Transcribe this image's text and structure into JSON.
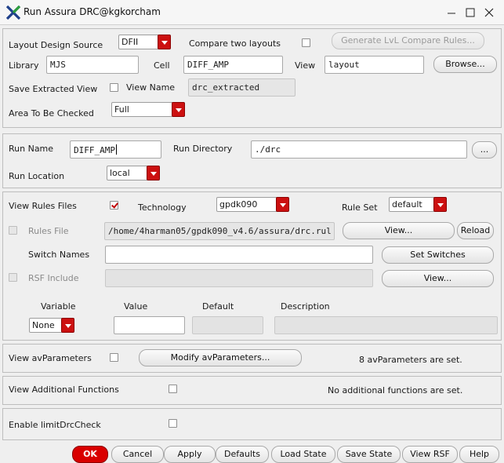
{
  "window": {
    "title": "Run Assura DRC@kgkorcham"
  },
  "layout_section": {
    "design_source_label": "Layout Design Source",
    "design_source_value": "DFII",
    "compare_label": "Compare two layouts",
    "compare_checked": false,
    "generate_button": "Generate LvL Compare Rules...",
    "library_label": "Library",
    "library_value": "MJS",
    "cell_label": "Cell",
    "cell_value": "DIFF_AMP",
    "view_label": "View",
    "view_value": "layout",
    "browse_button": "Browse...",
    "save_extracted_label": "Save Extracted View",
    "save_extracted_checked": false,
    "view_name_label": "View Name",
    "view_name_value": "drc_extracted",
    "area_label": "Area To Be Checked",
    "area_value": "Full"
  },
  "run_section": {
    "run_name_label": "Run Name",
    "run_name_value": "DIFF_AMP",
    "run_dir_label": "Run Directory",
    "run_dir_value": "./drc",
    "run_dir_browse": "...",
    "run_location_label": "Run Location",
    "run_location_value": "local"
  },
  "rules_section": {
    "view_rules_label": "View Rules Files",
    "view_rules_checked": true,
    "technology_label": "Technology",
    "technology_value": "gpdk090",
    "rule_set_label": "Rule Set",
    "rule_set_value": "default",
    "rules_file_label": "Rules File",
    "rules_file_value": "/home/4harman05/gpdk090_v4.6/assura/drc.rul",
    "rules_view_button": "View...",
    "reload_button": "Reload",
    "switch_names_label": "Switch Names",
    "switch_names_value": "",
    "set_switches_button": "Set Switches",
    "rsf_include_label": "RSF Include",
    "rsf_view_button": "View...",
    "variable_header": "Variable",
    "value_header": "Value",
    "default_header": "Default",
    "description_header": "Description",
    "variable_value": "None"
  },
  "avparams_section": {
    "label": "View avParameters",
    "checked": false,
    "modify_button": "Modify avParameters...",
    "status": "8 avParameters are set."
  },
  "functions_section": {
    "label": "View Additional Functions",
    "checked": false,
    "status": "No additional functions are set."
  },
  "limit_section": {
    "label": "Enable limitDrcCheck",
    "checked": false
  },
  "buttons": {
    "ok": "OK",
    "cancel": "Cancel",
    "apply": "Apply",
    "defaults": "Defaults",
    "load_state": "Load State",
    "save_state": "Save State",
    "view_rsf": "View RSF",
    "help": "Help"
  },
  "colors": {
    "accent_red": "#cc1010",
    "ok_button": "#d90000",
    "background": "#efefef"
  }
}
